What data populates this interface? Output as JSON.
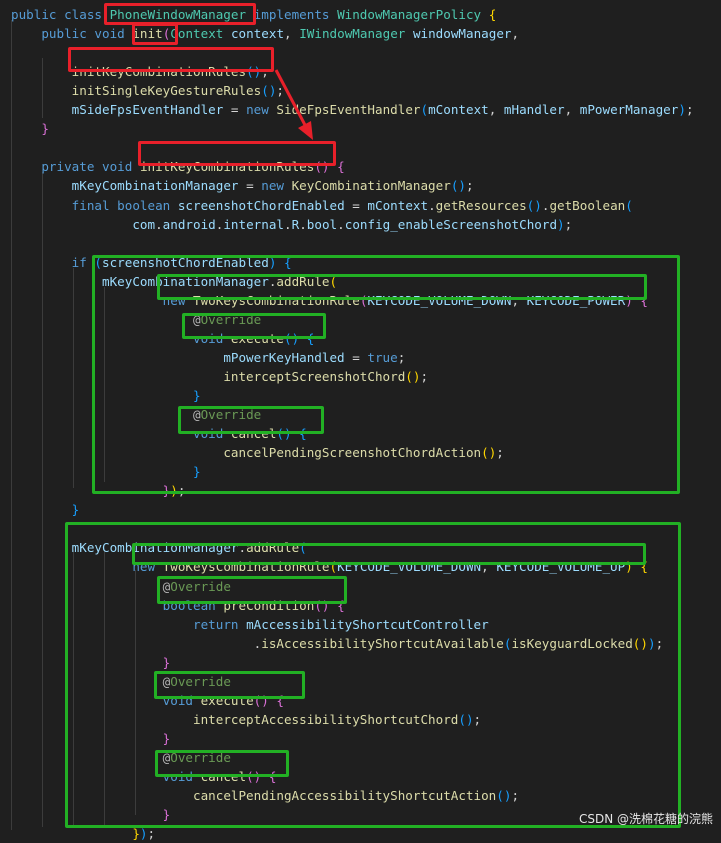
{
  "code": {
    "lines": [
      [
        [
          "kw",
          "public "
        ],
        [
          "kw",
          "class "
        ],
        [
          "cls",
          "PhoneWindowManager"
        ],
        [
          "plain",
          " "
        ],
        [
          "kw",
          "implements "
        ],
        [
          "cls",
          "WindowManagerPolicy "
        ],
        [
          "br1",
          "{"
        ]
      ],
      [
        [
          "plain",
          "    "
        ],
        [
          "kw",
          "public "
        ],
        [
          "kw",
          "void "
        ],
        [
          "fn",
          "init"
        ],
        [
          "br2",
          "("
        ],
        [
          "cls",
          "Context "
        ],
        [
          "var",
          "context"
        ],
        [
          "plain",
          ", "
        ],
        [
          "cls",
          "IWindowManager "
        ],
        [
          "var",
          "windowManager"
        ],
        [
          "plain",
          ","
        ]
      ],
      [],
      [
        [
          "plain",
          "        "
        ],
        [
          "fn",
          "initKeyCombinationRules"
        ],
        [
          "br3",
          "()"
        ],
        [
          "plain",
          ";"
        ]
      ],
      [
        [
          "plain",
          "        "
        ],
        [
          "fn",
          "initSingleKeyGestureRules"
        ],
        [
          "br3",
          "()"
        ],
        [
          "plain",
          ";"
        ]
      ],
      [
        [
          "plain",
          "        "
        ],
        [
          "var",
          "mSideFpsEventHandler"
        ],
        [
          "plain",
          " = "
        ],
        [
          "kw",
          "new "
        ],
        [
          "fn",
          "SideFpsEventHandler"
        ],
        [
          "br3",
          "("
        ],
        [
          "var",
          "mContext"
        ],
        [
          "plain",
          ", "
        ],
        [
          "var",
          "mHandler"
        ],
        [
          "plain",
          ", "
        ],
        [
          "var",
          "mPowerManager"
        ],
        [
          "br3",
          ")"
        ],
        [
          "plain",
          ";"
        ]
      ],
      [
        [
          "plain",
          "    "
        ],
        [
          "br2",
          "}"
        ]
      ],
      [],
      [
        [
          "plain",
          "    "
        ],
        [
          "kw",
          "private "
        ],
        [
          "kw",
          "void "
        ],
        [
          "fn",
          "initKeyCombinationRules"
        ],
        [
          "br2",
          "() {"
        ]
      ],
      [
        [
          "plain",
          "        "
        ],
        [
          "var",
          "mKeyCombinationManager"
        ],
        [
          "plain",
          " = "
        ],
        [
          "kw",
          "new "
        ],
        [
          "fn",
          "KeyCombinationManager"
        ],
        [
          "br3",
          "()"
        ],
        [
          "plain",
          ";"
        ]
      ],
      [
        [
          "plain",
          "        "
        ],
        [
          "kw",
          "final "
        ],
        [
          "kw",
          "boolean "
        ],
        [
          "var",
          "screenshotChordEnabled"
        ],
        [
          "plain",
          " = "
        ],
        [
          "var",
          "mContext"
        ],
        [
          "plain",
          "."
        ],
        [
          "fn",
          "getResources"
        ],
        [
          "br3",
          "()"
        ],
        [
          "plain",
          "."
        ],
        [
          "fn",
          "getBoolean"
        ],
        [
          "br3",
          "("
        ]
      ],
      [
        [
          "plain",
          "                "
        ],
        [
          "var",
          "com"
        ],
        [
          "plain",
          "."
        ],
        [
          "var",
          "android"
        ],
        [
          "plain",
          "."
        ],
        [
          "var",
          "internal"
        ],
        [
          "plain",
          "."
        ],
        [
          "var",
          "R"
        ],
        [
          "plain",
          "."
        ],
        [
          "var",
          "bool"
        ],
        [
          "plain",
          "."
        ],
        [
          "var",
          "config_enableScreenshotChord"
        ],
        [
          "br3",
          ")"
        ],
        [
          "plain",
          ";"
        ]
      ],
      [],
      [
        [
          "plain",
          "        "
        ],
        [
          "kw",
          "if "
        ],
        [
          "br3",
          "("
        ],
        [
          "var",
          "screenshotChordEnabled"
        ],
        [
          "br3",
          ") {"
        ]
      ],
      [
        [
          "plain",
          "            "
        ],
        [
          "var",
          "mKeyCombinationManager"
        ],
        [
          "plain",
          "."
        ],
        [
          "fn",
          "addRule"
        ],
        [
          "br1",
          "("
        ]
      ],
      [
        [
          "plain",
          "                    "
        ],
        [
          "kw",
          "new "
        ],
        [
          "fn",
          "TwoKeysCombinationRule"
        ],
        [
          "br2",
          "("
        ],
        [
          "var",
          "KEYCODE_VOLUME_DOWN"
        ],
        [
          "plain",
          ", "
        ],
        [
          "var",
          "KEYCODE_POWER"
        ],
        [
          "br2",
          ") {"
        ]
      ],
      [
        [
          "plain",
          "                        "
        ],
        [
          "ann",
          "@"
        ],
        [
          "ann2",
          "Override"
        ]
      ],
      [
        [
          "plain",
          "                        "
        ],
        [
          "kw",
          "void "
        ],
        [
          "fn",
          "execute"
        ],
        [
          "br3",
          "() {"
        ]
      ],
      [
        [
          "plain",
          "                            "
        ],
        [
          "var",
          "mPowerKeyHandled"
        ],
        [
          "plain",
          " = "
        ],
        [
          "kw",
          "true"
        ],
        [
          "plain",
          ";"
        ]
      ],
      [
        [
          "plain",
          "                            "
        ],
        [
          "fn",
          "interceptScreenshotChord"
        ],
        [
          "br1",
          "()"
        ],
        [
          "plain",
          ";"
        ]
      ],
      [
        [
          "plain",
          "                        "
        ],
        [
          "br3",
          "}"
        ]
      ],
      [
        [
          "plain",
          "                        "
        ],
        [
          "ann",
          "@"
        ],
        [
          "ann2",
          "Override"
        ]
      ],
      [
        [
          "plain",
          "                        "
        ],
        [
          "kw",
          "void "
        ],
        [
          "fn",
          "cancel"
        ],
        [
          "br3",
          "() {"
        ]
      ],
      [
        [
          "plain",
          "                            "
        ],
        [
          "fn",
          "cancelPendingScreenshotChordAction"
        ],
        [
          "br1",
          "()"
        ],
        [
          "plain",
          ";"
        ]
      ],
      [
        [
          "plain",
          "                        "
        ],
        [
          "br3",
          "}"
        ]
      ],
      [
        [
          "plain",
          "                    "
        ],
        [
          "br2",
          "}"
        ],
        [
          "br1",
          ")"
        ],
        [
          "plain",
          ";"
        ]
      ],
      [
        [
          "plain",
          "        "
        ],
        [
          "br3",
          "}"
        ]
      ],
      [],
      [
        [
          "plain",
          "        "
        ],
        [
          "var",
          "mKeyCombinationManager"
        ],
        [
          "plain",
          "."
        ],
        [
          "fn",
          "addRule"
        ],
        [
          "br3",
          "("
        ]
      ],
      [
        [
          "plain",
          "                "
        ],
        [
          "kw",
          "new "
        ],
        [
          "fn",
          "TwoKeysCombinationRule"
        ],
        [
          "br1",
          "("
        ],
        [
          "var",
          "KEYCODE_VOLUME_DOWN"
        ],
        [
          "plain",
          ", "
        ],
        [
          "var",
          "KEYCODE_VOLUME_UP"
        ],
        [
          "br1",
          ") {"
        ]
      ],
      [
        [
          "plain",
          "                    "
        ],
        [
          "ann",
          "@"
        ],
        [
          "ann2",
          "Override"
        ]
      ],
      [
        [
          "plain",
          "                    "
        ],
        [
          "kw",
          "boolean "
        ],
        [
          "fn",
          "preCondition"
        ],
        [
          "br2",
          "() {"
        ]
      ],
      [
        [
          "plain",
          "                        "
        ],
        [
          "kw",
          "return "
        ],
        [
          "var",
          "mAccessibilityShortcutController"
        ]
      ],
      [
        [
          "plain",
          "                                "
        ],
        [
          "plain",
          "."
        ],
        [
          "fn",
          "isAccessibilityShortcutAvailable"
        ],
        [
          "br3",
          "("
        ],
        [
          "fn",
          "isKeyguardLocked"
        ],
        [
          "br1",
          "()"
        ],
        [
          "br3",
          ")"
        ],
        [
          "plain",
          ";"
        ]
      ],
      [
        [
          "plain",
          "                    "
        ],
        [
          "br2",
          "}"
        ]
      ],
      [
        [
          "plain",
          "                    "
        ],
        [
          "ann",
          "@"
        ],
        [
          "ann2",
          "Override"
        ]
      ],
      [
        [
          "plain",
          "                    "
        ],
        [
          "kw",
          "void "
        ],
        [
          "fn",
          "execute"
        ],
        [
          "br2",
          "() {"
        ]
      ],
      [
        [
          "plain",
          "                        "
        ],
        [
          "fn",
          "interceptAccessibilityShortcutChord"
        ],
        [
          "br3",
          "()"
        ],
        [
          "plain",
          ";"
        ]
      ],
      [
        [
          "plain",
          "                    "
        ],
        [
          "br2",
          "}"
        ]
      ],
      [
        [
          "plain",
          "                    "
        ],
        [
          "ann",
          "@"
        ],
        [
          "ann2",
          "Override"
        ]
      ],
      [
        [
          "plain",
          "                    "
        ],
        [
          "kw",
          "void "
        ],
        [
          "fn",
          "cancel"
        ],
        [
          "br2",
          "() {"
        ]
      ],
      [
        [
          "plain",
          "                        "
        ],
        [
          "fn",
          "cancelPendingAccessibilityShortcutAction"
        ],
        [
          "br3",
          "()"
        ],
        [
          "plain",
          ";"
        ]
      ],
      [
        [
          "plain",
          "                    "
        ],
        [
          "br2",
          "}"
        ]
      ],
      [
        [
          "plain",
          "                "
        ],
        [
          "br1",
          "}"
        ],
        [
          "br3",
          ")"
        ],
        [
          "plain",
          ";"
        ]
      ]
    ]
  },
  "highlight_colors": {
    "red": "#e8202a",
    "green": "#22b024"
  },
  "watermark": "CSDN @洗棉花糖的浣熊"
}
